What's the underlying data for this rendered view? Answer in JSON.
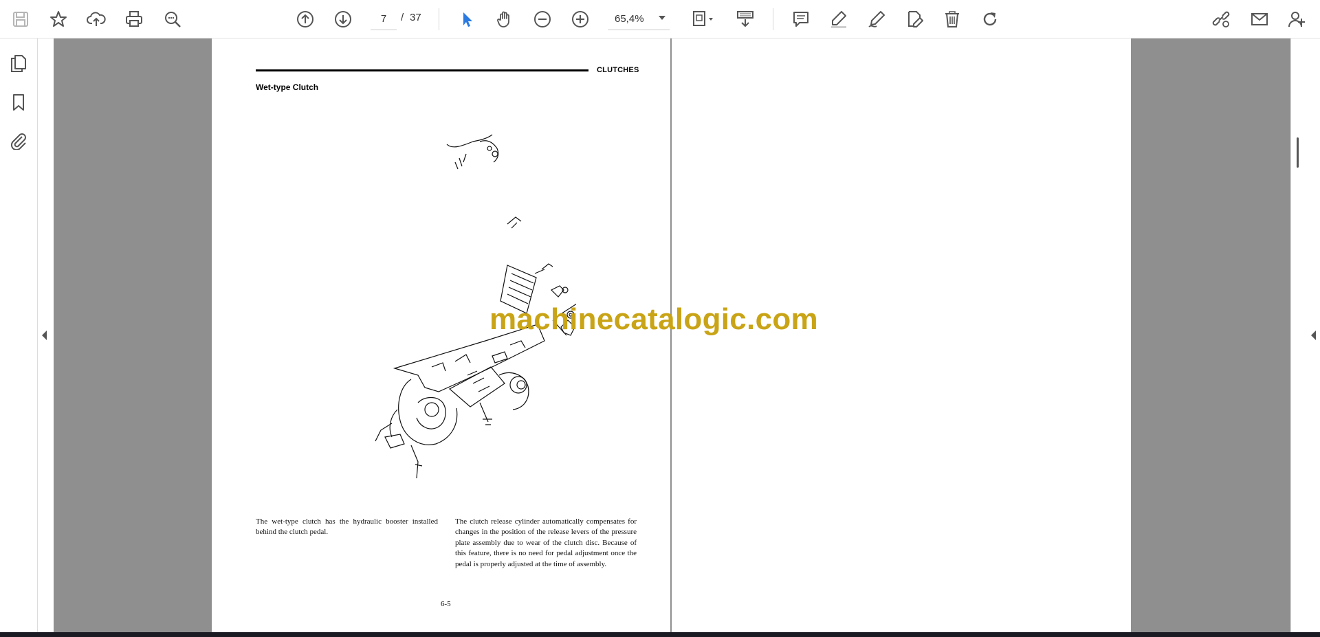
{
  "toolbar": {
    "current_page": "7",
    "page_separator": "/",
    "total_pages": "37",
    "zoom_level": "65,4%",
    "icons": [
      "save-icon",
      "bookmark-star-icon",
      "upload-cloud-icon",
      "print-icon",
      "search-zoom-icon",
      "page-up-icon",
      "page-down-icon",
      "select-arrow-icon",
      "hand-tool-icon",
      "zoom-out-icon",
      "zoom-in-icon",
      "page-display-icon",
      "scroll-mode-icon",
      "comment-icon",
      "highlight-icon",
      "draw-pen-icon",
      "fill-sign-icon",
      "delete-icon",
      "rotate-icon",
      "share-link-icon",
      "email-icon",
      "add-user-icon"
    ],
    "accent_color": "#2a7ae2"
  },
  "left_panel": {
    "icons": [
      "page-thumbnails-icon",
      "bookmarks-icon",
      "attachments-icon"
    ]
  },
  "document": {
    "section_label": "CLUTCHES",
    "page_title": "Wet-type Clutch",
    "paragraph_left": "The wet-type clutch has the hydraulic booster installed behind the clutch pedal.",
    "paragraph_right": "The clutch release cylinder automatically compensates for changes in the position of the release levers of the pressure plate assembly due to wear of the clutch disc. Because of this feature, there is no need for pedal adjustment once the pedal is properly adjusted at the time of assembly.",
    "page_number": "6-5",
    "watermark": "machinecatalogic.com",
    "watermark_color": "#c9a416"
  }
}
